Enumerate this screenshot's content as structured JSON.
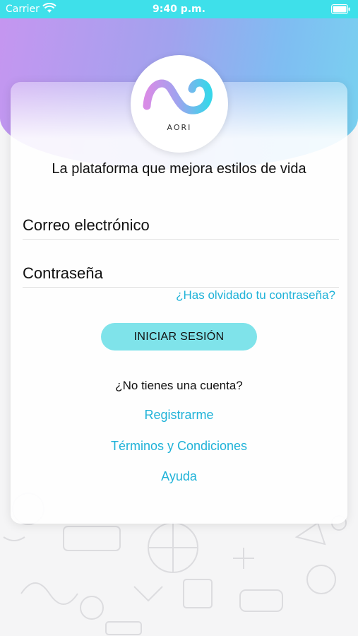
{
  "status_bar": {
    "carrier": "Carrier",
    "time": "9:40 p.m.",
    "wifi_icon": "wifi-icon",
    "battery_icon": "battery-full-icon"
  },
  "colors": {
    "status_bar": "#3ee0ea",
    "header_gradient_start": "#c596f0",
    "header_gradient_end": "#79d2f0",
    "link": "#1fb2d8",
    "button": "#7fe3ea"
  },
  "logo": {
    "text": "AORI",
    "icon": "aori-wave-logo"
  },
  "tagline": "La plataforma que mejora estilos de vida",
  "form": {
    "email_placeholder": "Correo electrónico",
    "password_placeholder": "Contraseña",
    "forgot_password": "¿Has olvidado tu contraseña?",
    "login_button": "INICIAR SESIÓN"
  },
  "footer": {
    "no_account": "¿No tienes una cuenta?",
    "register": "Registrarme",
    "terms": "Términos y Condiciones",
    "help": "Ayuda"
  }
}
